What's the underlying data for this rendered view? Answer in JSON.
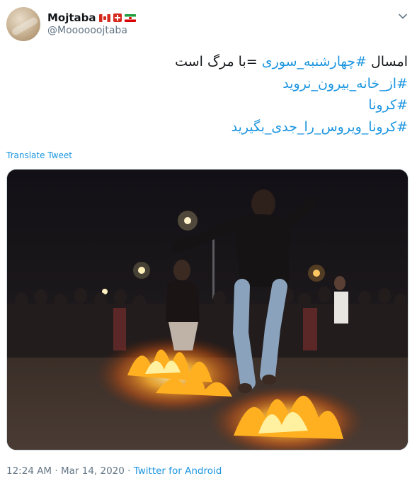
{
  "author": {
    "display_name": "Mojtaba",
    "flags": [
      "canada-flag",
      "switzerland-flag",
      "iran-flag"
    ],
    "handle": "@Moooooojtaba"
  },
  "tweet": {
    "line1_plain_start": "امسال ",
    "line1_tag": "#چهارشنبه_سوری",
    "line1_plain_end": " =با مرگ است",
    "line2_tag": "#از_خانه_بیرون_نروید",
    "line3_tag": "#کرونا",
    "line4_tag": "#کرونا_ویروس_را_جدی_بگیرید"
  },
  "translate_label": "Translate Tweet",
  "media": {
    "description_icon": "photo-bonfire-jump"
  },
  "meta": {
    "time": "12:24 AM",
    "sep1": " · ",
    "date": "Mar 14, 2020",
    "sep2": " · ",
    "source": "Twitter for Android"
  },
  "colors": {
    "link": "#1b95e0",
    "text": "#14171a",
    "secondary": "#657786"
  }
}
